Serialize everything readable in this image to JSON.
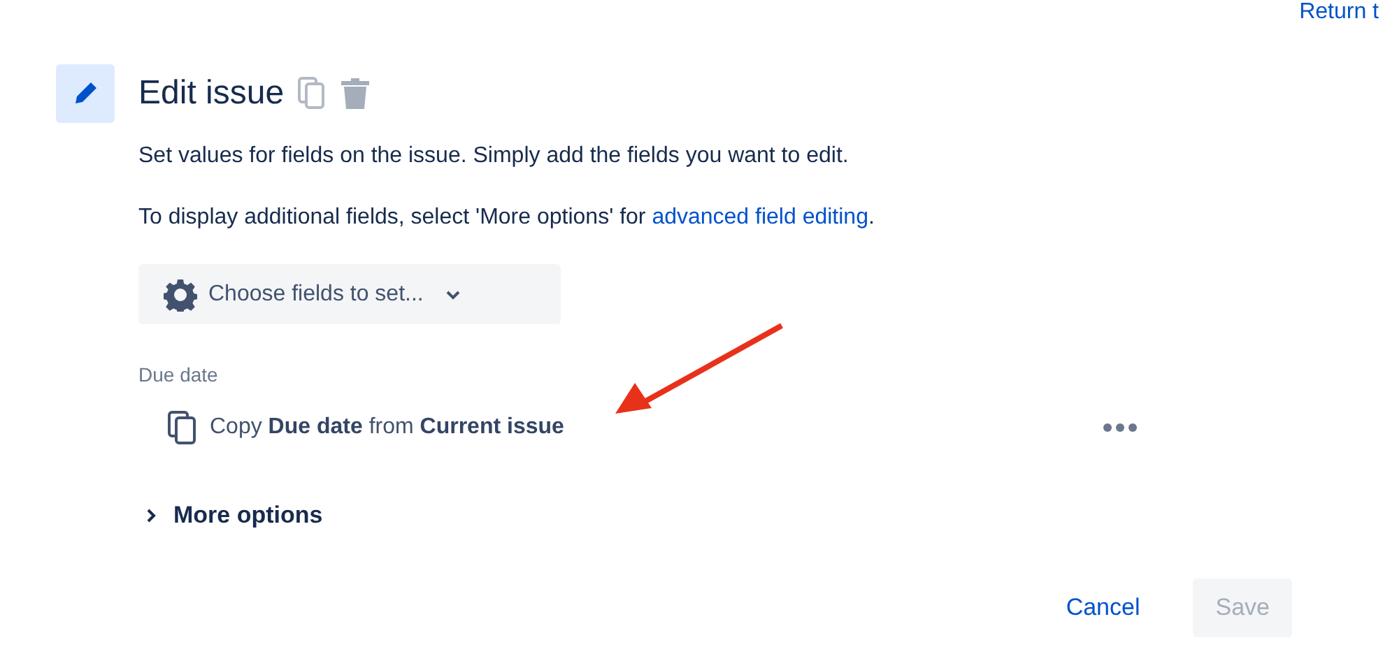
{
  "top_link": "Return t",
  "action": {
    "title": "Edit issue",
    "description": "Set values for fields on the issue. Simply add the fields you want to edit.",
    "note": "To display additional fields, select 'More options' for ",
    "note_link": "advanced field editing",
    "note_end": ".",
    "choose_button": "Choose fields to set...",
    "fields": [
      {
        "label": "Due date",
        "value": "Copy **Due date** from **Current issue**"
      }
    ],
    "more_options": {
      "label": "More options",
      "expanded": false
    }
  },
  "buttons": [
    {
      "label": "Cancel",
      "kind": "link",
      "disabled": false
    },
    {
      "label": "Save",
      "kind": "primary",
      "disabled": true
    }
  ]
}
